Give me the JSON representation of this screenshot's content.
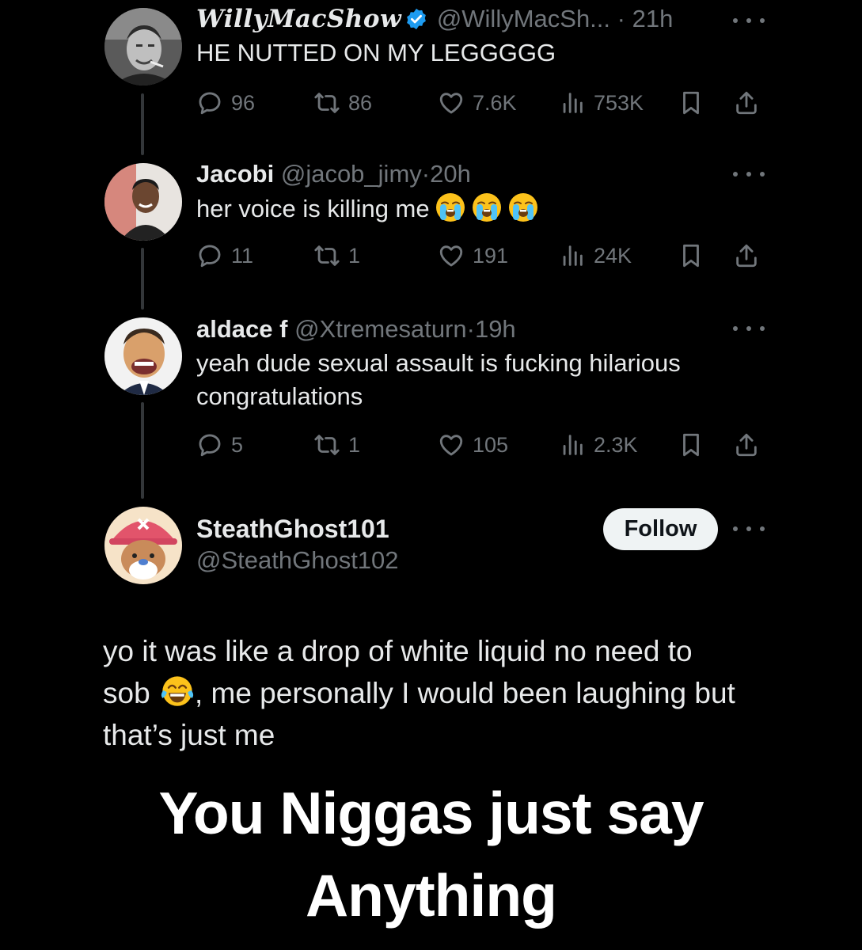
{
  "tweets": [
    {
      "display_name": "WillyMacShow",
      "verified": true,
      "handle": "@WillyMacSh...",
      "dot": "·",
      "time": "21h",
      "text": "HE NUTTED ON MY LEGGGGG",
      "replies": "96",
      "reposts": "86",
      "likes": "7.6K",
      "views": "753K"
    },
    {
      "display_name": "Jacobi",
      "handle": "@jacob_jimy",
      "dot": "·",
      "time": "20h",
      "text": "her voice is killing me",
      "emoji": [
        "loudly-crying-face",
        "loudly-crying-face",
        "loudly-crying-face"
      ],
      "replies": "11",
      "reposts": "1",
      "likes": "191",
      "views": "24K"
    },
    {
      "display_name": "aldace f",
      "handle": "@Xtremesaturn",
      "dot": "·",
      "time": "19h",
      "text_line1": "yeah dude sexual assault is fucking hilarious",
      "text_line2": "congratulations",
      "replies": "5",
      "reposts": "1",
      "likes": "105",
      "views": "2.3K"
    }
  ],
  "main_post": {
    "display_name": "SteathGhost101",
    "handle": "@SteathGhost102",
    "follow_label": "Follow",
    "text_line1": "yo it was like a drop of white liquid no need to",
    "text_line2_a": "sob",
    "text_line2_b": ", me personally I would been laughing but",
    "text_line3": "that’s just me",
    "emoji": "face-with-tears-of-joy"
  },
  "caption": {
    "line1": "You Niggas just say",
    "line2": "Anything"
  },
  "colors": {
    "background": "#000000",
    "text": "#e7e9ea",
    "muted": "#71767b",
    "verified_blue": "#1d9bf0",
    "thread_line": "#333639",
    "follow_bg": "#eff3f4"
  }
}
